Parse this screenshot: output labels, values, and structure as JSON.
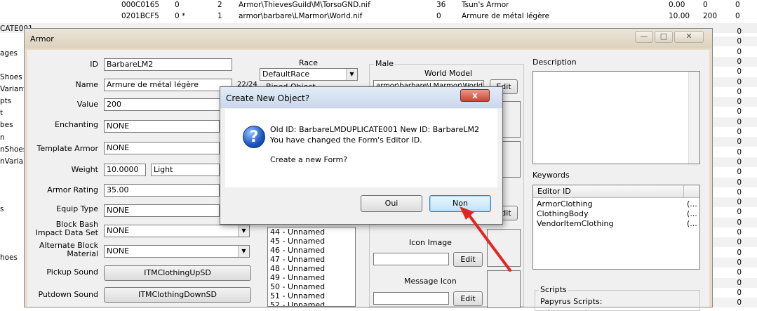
{
  "bg_list": {
    "rows": [
      {
        "id": "000C0165",
        "c1": "0",
        "c2": "2",
        "model": "Armor\\ThievesGuild\\M\\TorsoGND.nif",
        "n": "36",
        "name": "Tsun's Armor",
        "v": "0.00",
        "w": "0",
        "r": "0"
      },
      {
        "id": "0201BCF5",
        "c1": "0 *",
        "c2": "1",
        "model": "armor\\barbare\\LMarmor\\World.nif",
        "n": "0",
        "name": "Armure de métal légère",
        "v": "10.00",
        "w": "200",
        "r": "0"
      }
    ],
    "left_labels": [
      "CATE001",
      "ages",
      "Shoes",
      "Variant",
      "pts",
      "t",
      "bes",
      "n",
      "nShoes",
      "nVarian",
      "s",
      "hoes"
    ],
    "right_col": [
      "0",
      "0",
      "0",
      "0",
      "0",
      "0",
      "0",
      "0",
      "0",
      "0",
      "0",
      "0",
      "0",
      "0",
      "0",
      "0",
      "0",
      "0",
      "0",
      "0",
      "0",
      "0",
      "0",
      "0",
      "0",
      "0",
      "0",
      "0"
    ]
  },
  "armor": {
    "title": "Armor",
    "labels": {
      "id": "ID",
      "name": "Name",
      "value": "Value",
      "enchanting": "Enchanting",
      "template": "Template Armor",
      "weight": "Weight",
      "rating": "Armor Rating",
      "equip": "Equip Type",
      "block_bash": "Block Bash\nImpact Data Set",
      "alt_block": "Alternate Block\nMaterial",
      "pickup": "Pickup Sound",
      "putdown": "Putdown Sound"
    },
    "values": {
      "id": "BarbareLM2",
      "name": "Armure de métal légère",
      "name_count": "22/24",
      "value": "200",
      "enchanting": "NONE",
      "template": "NONE",
      "weight": "10.0000",
      "weight_type": "Light",
      "rating": "35.00",
      "equip": "NONE",
      "block_bash": "NONE",
      "alt_block": "NONE",
      "pickup": "ITMClothingUpSD",
      "putdown": "ITMClothingDownSD"
    },
    "race": {
      "label": "Race",
      "selected": "DefaultRace",
      "partial": "Biped Object"
    },
    "biped_list": [
      "44 - Unnamed",
      "45 - Unnamed",
      "46 - Unnamed",
      "47 - Unnamed",
      "48 - Unnamed",
      "49 - Unnamed",
      "50 - Unnamed",
      "51 - Unnamed",
      "52 - Unnamed"
    ],
    "male": {
      "label": "Male",
      "world_model": "World Model",
      "world_path": "armor\\barbare\\LMarmor\\World.ni",
      "edit": "Edit",
      "icon_image": "Icon Image",
      "message_icon": "Message Icon"
    },
    "description": {
      "label": "Description"
    },
    "keywords": {
      "label": "Keywords",
      "column": "Editor ID",
      "items": [
        "ArmorClothing",
        "ClothingBody",
        "VendorItemClothing"
      ],
      "suffix": "(..."
    },
    "scripts": {
      "label": "Scripts",
      "papyrus": "Papyrus Scripts:"
    }
  },
  "dialog": {
    "title": "Create New Object?",
    "line1": "Old ID: BarbareLMDUPLICATE001 New ID: BarbareLM2",
    "line2": "You have changed the Form's Editor ID.",
    "line3": "Create a new Form?",
    "close": "x",
    "yes": "Oui",
    "no": "Non"
  },
  "annotation_color": "#e8231f"
}
